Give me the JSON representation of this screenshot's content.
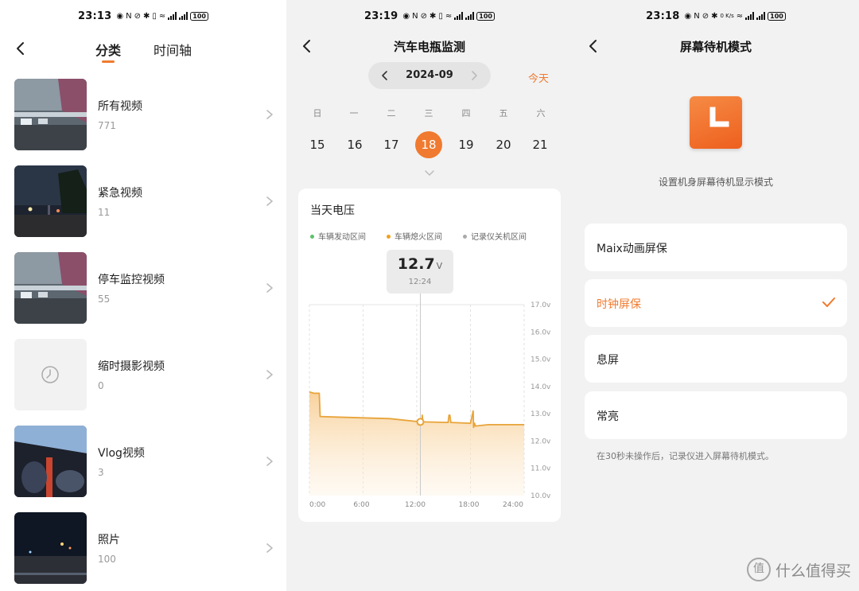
{
  "screen1": {
    "status_time": "23:13",
    "tabs": [
      {
        "label": "分类",
        "active": true
      },
      {
        "label": "时间轴",
        "active": false
      }
    ],
    "albums": [
      {
        "title": "所有视频",
        "count": "771",
        "thumb": "parking-garage"
      },
      {
        "title": "紧急视频",
        "count": "11",
        "thumb": "night-street"
      },
      {
        "title": "停车监控视频",
        "count": "55",
        "thumb": "parking-garage"
      },
      {
        "title": "缩时摄影视频",
        "count": "0",
        "thumb": "timelapse-placeholder"
      },
      {
        "title": "Vlog视频",
        "count": "3",
        "thumb": "car-interior"
      },
      {
        "title": "照片",
        "count": "100",
        "thumb": "night-road"
      }
    ]
  },
  "screen2": {
    "status_time": "23:19",
    "title": "汽车电瓶监测",
    "month": "2024-09",
    "today_label": "今天",
    "weekdays": [
      "日",
      "一",
      "二",
      "三",
      "四",
      "五",
      "六"
    ],
    "days": [
      "15",
      "16",
      "17",
      "18",
      "19",
      "20",
      "21"
    ],
    "selected_day": "18",
    "card_title": "当天电压",
    "legend": [
      {
        "label": "车辆发动区间",
        "color": "#5cc26a"
      },
      {
        "label": "车辆熄火区间",
        "color": "#f0a21f"
      },
      {
        "label": "记录仪关机区间",
        "color": "#aaaaaa"
      }
    ],
    "tooltip": {
      "value": "12.7",
      "unit": "V",
      "time": "12:24"
    },
    "chart_data": {
      "type": "area",
      "title": "",
      "xlabel": "",
      "ylabel": "",
      "x_ticks": [
        "0:00",
        "6:00",
        "12:00",
        "18:00",
        "24:00"
      ],
      "y_ticks": [
        "17.0v",
        "16.0v",
        "15.0v",
        "14.0v",
        "13.0v",
        "12.0v",
        "11.0v",
        "10.0v"
      ],
      "xlim": [
        0,
        24
      ],
      "ylim": [
        10,
        17
      ],
      "grid": true,
      "series": [
        {
          "x": [
            0,
            0.5,
            0.5,
            1.1,
            1.2,
            3,
            6,
            9,
            12.4,
            12.6,
            12.6,
            12.7,
            12.8,
            15.5,
            15.6,
            15.7,
            15.8,
            18,
            18.3,
            18.35,
            18.45,
            18.55,
            20,
            22,
            24
          ],
          "y": [
            13.8,
            13.75,
            13.75,
            13.75,
            12.9,
            12.88,
            12.85,
            12.82,
            12.7,
            12.7,
            12.95,
            12.7,
            12.7,
            12.68,
            12.95,
            12.95,
            12.68,
            12.65,
            13.1,
            12.5,
            12.65,
            12.55,
            12.6,
            12.6,
            12.6
          ],
          "color": "#e8a43a"
        }
      ],
      "highlight": {
        "x": 12.4,
        "y": 12.7
      }
    }
  },
  "screen3": {
    "status_time": "23:18",
    "title": "屏幕待机模式",
    "description": "设置机身屏幕待机显示模式",
    "options": [
      {
        "label": "Maix动画屏保",
        "selected": false
      },
      {
        "label": "时钟屏保",
        "selected": true
      },
      {
        "label": "息屏",
        "selected": false
      },
      {
        "label": "常亮",
        "selected": false
      }
    ],
    "note": "在30秒未操作后，记录仪进入屏幕待机模式。"
  },
  "status_icons": {
    "battery": "100",
    "net_speed": "0 K/s"
  },
  "watermark": {
    "text": "什么值得买",
    "icon": "值"
  },
  "accent_color": "#f07a2f"
}
